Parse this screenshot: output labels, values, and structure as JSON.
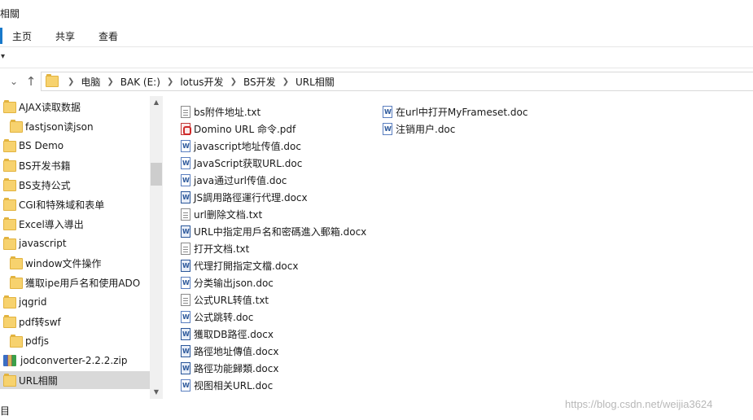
{
  "window": {
    "title": "相關"
  },
  "ribbon": {
    "tabs": [
      "主页",
      "共享",
      "查看"
    ]
  },
  "address": {
    "crumbs": [
      "电脑",
      "BAK (E:)",
      "lotus开发",
      "BS开发",
      "URL相關"
    ]
  },
  "tree": {
    "items": [
      {
        "label": "AJAX读取数据",
        "icon": "folder-icon",
        "indent": 0,
        "selected": false
      },
      {
        "label": "fastjson读json",
        "icon": "folder-icon",
        "indent": 1,
        "selected": false
      },
      {
        "label": "BS Demo",
        "icon": "folder-icon",
        "indent": 0,
        "selected": false
      },
      {
        "label": "BS开发书籍",
        "icon": "folder-icon",
        "indent": 0,
        "selected": false
      },
      {
        "label": "BS支持公式",
        "icon": "folder-icon",
        "indent": 0,
        "selected": false
      },
      {
        "label": "CGI和特殊域和表单",
        "icon": "folder-icon",
        "indent": 0,
        "selected": false
      },
      {
        "label": "Excel導入導出",
        "icon": "folder-icon",
        "indent": 0,
        "selected": false
      },
      {
        "label": "javascript",
        "icon": "folder-icon",
        "indent": 0,
        "selected": false
      },
      {
        "label": "window文件操作",
        "icon": "folder-icon",
        "indent": 1,
        "selected": false
      },
      {
        "label": "獲取ipe用戶名和使用ADO",
        "icon": "folder-icon",
        "indent": 1,
        "selected": false
      },
      {
        "label": "jqgrid",
        "icon": "folder-icon",
        "indent": 0,
        "selected": false
      },
      {
        "label": "pdf转swf",
        "icon": "folder-icon",
        "indent": 0,
        "selected": false
      },
      {
        "label": "pdfjs",
        "icon": "folder-icon",
        "indent": 1,
        "selected": false
      },
      {
        "label": "jodconverter-2.2.2.zip",
        "icon": "zip-icon",
        "indent": 0,
        "selected": false
      },
      {
        "label": "URL相關",
        "icon": "folder-icon",
        "indent": 0,
        "selected": true
      }
    ]
  },
  "files": {
    "column1": [
      {
        "label": "bs附件地址.txt",
        "type": "txt"
      },
      {
        "label": "Domino URL 命令.pdf",
        "type": "pdf"
      },
      {
        "label": "javascript地址传值.doc",
        "type": "doc"
      },
      {
        "label": "JavaScript获取URL.doc",
        "type": "doc"
      },
      {
        "label": "java通过url传值.doc",
        "type": "doc"
      },
      {
        "label": "JS調用路徑運行代理.docx",
        "type": "docx"
      },
      {
        "label": "url删除文档.txt",
        "type": "txt"
      },
      {
        "label": "URL中指定用戶名和密碼進入郵箱.docx",
        "type": "docx"
      },
      {
        "label": "打开文档.txt",
        "type": "txt"
      },
      {
        "label": "代理打開指定文檔.docx",
        "type": "docx"
      },
      {
        "label": "分类输出json.doc",
        "type": "doc"
      },
      {
        "label": "公式URL转值.txt",
        "type": "txt"
      },
      {
        "label": "公式跳转.doc",
        "type": "doc"
      },
      {
        "label": "獲取DB路徑.docx",
        "type": "docx"
      },
      {
        "label": "路徑地址傳值.docx",
        "type": "docx"
      },
      {
        "label": "路徑功能歸類.docx",
        "type": "docx"
      },
      {
        "label": "视图相关URL.doc",
        "type": "doc"
      }
    ],
    "column2": [
      {
        "label": "在url中打开MyFrameset.doc",
        "type": "doc"
      },
      {
        "label": "注销用户.doc",
        "type": "doc"
      }
    ]
  },
  "status": {
    "text": "目"
  },
  "watermark": {
    "text": "https://blog.csdn.net/weijia3624"
  }
}
